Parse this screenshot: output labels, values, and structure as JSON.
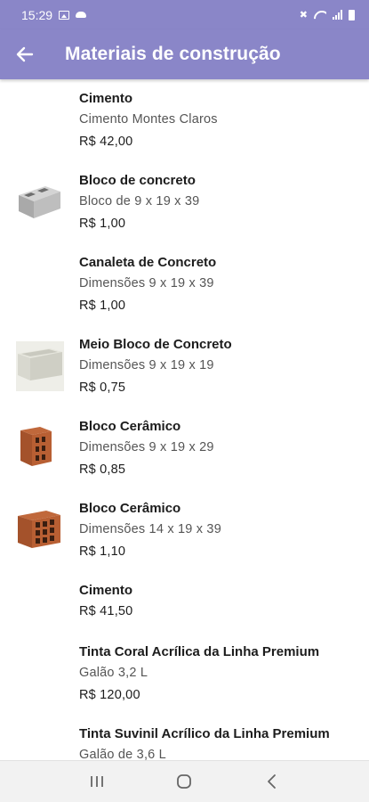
{
  "status_bar": {
    "time": "15:29",
    "left_icons": [
      "image-icon",
      "cloud-icon"
    ],
    "right_icons": [
      "mute-icon",
      "wifi-icon",
      "signal-icon",
      "battery-icon"
    ]
  },
  "app_bar": {
    "back_icon": "arrow-left-icon",
    "title": "Materiais de construção",
    "color": "#8a86c8"
  },
  "products": [
    {
      "name": "Cimento",
      "description": "Cimento Montes Claros",
      "price": "R$ 42,00",
      "image": "none"
    },
    {
      "name": "Bloco de concreto",
      "description": "Bloco de 9 x 19 x 39",
      "price": "R$ 1,00",
      "image": "concrete-block-image"
    },
    {
      "name": "Canaleta de Concreto",
      "description": "Dimensões 9 x 19 x 39",
      "price": "R$ 1,00",
      "image": "none"
    },
    {
      "name": "Meio Bloco de Concreto",
      "description": "Dimensões 9 x 19 x 19",
      "price": "R$ 0,75",
      "image": "half-concrete-block-image"
    },
    {
      "name": "Bloco Cerâmico",
      "description": "Dimensões 9 x 19 x 29",
      "price": "R$ 0,85",
      "image": "ceramic-block-image"
    },
    {
      "name": "Bloco Cerâmico",
      "description": "Dimensões 14 x 19 x 39",
      "price": "R$ 1,10",
      "image": "ceramic-block-large-image"
    },
    {
      "name": "Cimento",
      "price": "R$ 41,50",
      "image": "none"
    },
    {
      "name": "Tinta Coral Acrílica da Linha Premium",
      "description": "Galão 3,2 L",
      "price": "R$ 120,00",
      "image": "none"
    },
    {
      "name": "Tinta Suvinil Acrílico da Linha Premium",
      "description": "Galão de 3,6 L",
      "image": "none"
    }
  ],
  "nav_bar": {
    "buttons": [
      "recent-apps-icon",
      "home-icon",
      "back-icon"
    ]
  }
}
